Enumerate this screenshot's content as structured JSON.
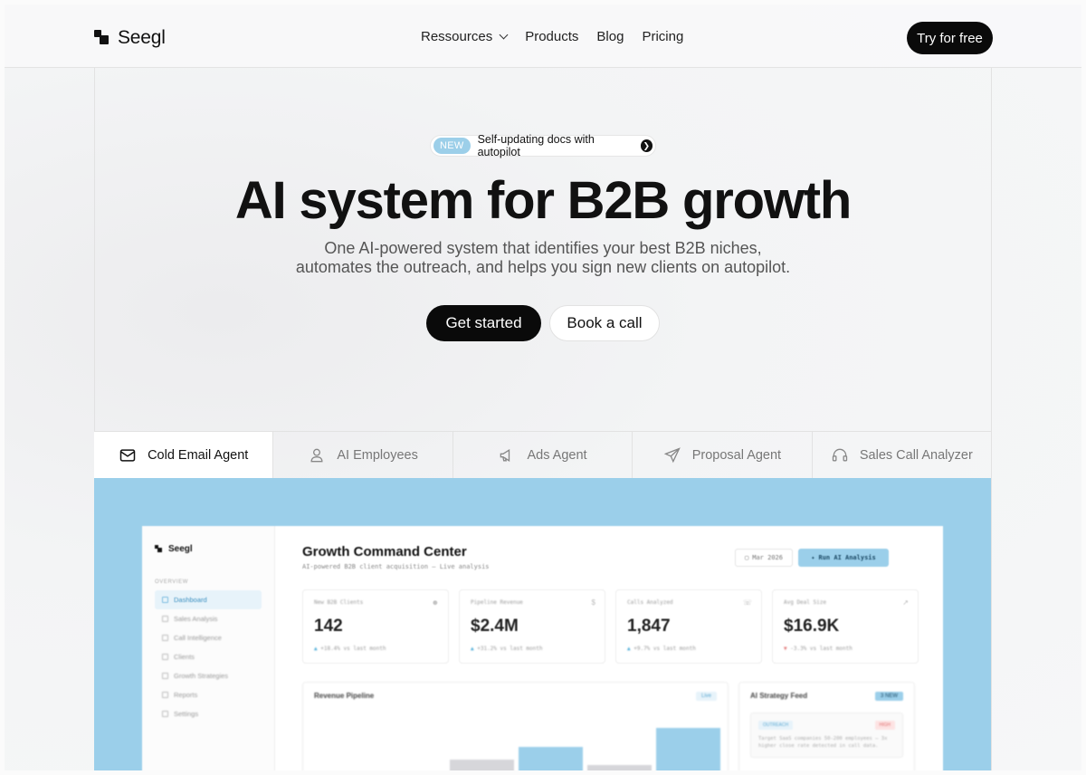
{
  "nav": {
    "logo_text": "Seegl",
    "menu": [
      "Ressources",
      "Products",
      "Blog",
      "Pricing"
    ],
    "cta": "Try for free"
  },
  "hero": {
    "badge_new": "NEW",
    "badge_text": "Self-updating docs with autopilot",
    "title": "AI system for B2B growth",
    "subtitle_line1": "One AI-powered system that identifies your best B2B niches,",
    "subtitle_line2": "automates the outreach, and helps you sign new clients on autopilot.",
    "primary_cta": "Get started",
    "secondary_cta": "Book a call"
  },
  "tabs": [
    {
      "label": "Cold Email Agent",
      "icon": "mail-icon",
      "active": true
    },
    {
      "label": "AI Employees",
      "icon": "person-icon",
      "active": false
    },
    {
      "label": "Ads Agent",
      "icon": "megaphone-icon",
      "active": false
    },
    {
      "label": "Proposal Agent",
      "icon": "send-icon",
      "active": false
    },
    {
      "label": "Sales Call Analyzer",
      "icon": "headset-icon",
      "active": false
    }
  ],
  "dashboard": {
    "logo_text": "Seegl",
    "section_label": "OVERVIEW",
    "sidebar": [
      "Dashboard",
      "Sales Analysis",
      "Call Intelligence",
      "Clients",
      "Growth Strategies",
      "Reports",
      "Settings"
    ],
    "title": "Growth Command Center",
    "subtitle": "AI-powered B2B client acquisition — Live analysis",
    "date_label": "Mar 2026",
    "run_label": "Run AI Analysis",
    "stats": [
      {
        "label": "New B2B Clients",
        "value": "142",
        "delta": "+18.4% vs last month",
        "trend": "up",
        "icon": "users-icon"
      },
      {
        "label": "Pipeline Revenue",
        "value": "$2.4M",
        "delta": "+31.2% vs last month",
        "trend": "up",
        "icon": "dollar-icon"
      },
      {
        "label": "Calls Analyzed",
        "value": "1,847",
        "delta": "+9.7% vs last month",
        "trend": "up",
        "icon": "phone-icon"
      },
      {
        "label": "Avg Deal Size",
        "value": "$16.9K",
        "delta": "-3.3% vs last month",
        "trend": "down",
        "icon": "trend-icon"
      }
    ],
    "revenue_title": "Revenue Pipeline",
    "revenue_live": "Live",
    "revenue_bars": [
      0.18,
      0.44,
      0.62,
      0.36,
      0.9
    ],
    "feed_title": "AI Strategy Feed",
    "feed_count": "3 NEW",
    "feed_card": {
      "tag": "OUTREACH",
      "badge": "HIGH",
      "text": "Target SaaS companies 50-200 employees — 3x higher close rate detected in call data."
    }
  },
  "colors": {
    "accent_blue": "#9bcfea",
    "dark": "#0a0a0a"
  }
}
